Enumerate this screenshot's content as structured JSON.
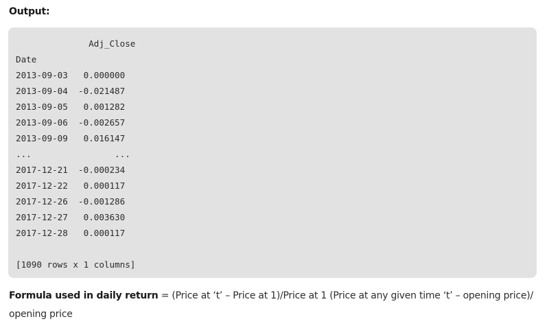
{
  "output_heading": "Output:",
  "code_lines": [
    "              Adj_Close",
    "Date",
    "2013-09-03   0.000000",
    "2013-09-04  -0.021487",
    "2013-09-05   0.001282",
    "2013-09-06  -0.002657",
    "2013-09-09   0.016147",
    "...                ...",
    "2017-12-21  -0.000234",
    "2017-12-22   0.000117",
    "2017-12-26  -0.001286",
    "2017-12-27   0.003630",
    "2017-12-28   0.000117",
    "",
    "[1090 rows x 1 columns]"
  ],
  "formula": {
    "label": "Formula used in daily return",
    "text": " = (Price at ‘t’ – Price at 1)/Price at 1 (Price at any given time ‘t’ – opening price)/ opening price"
  }
}
